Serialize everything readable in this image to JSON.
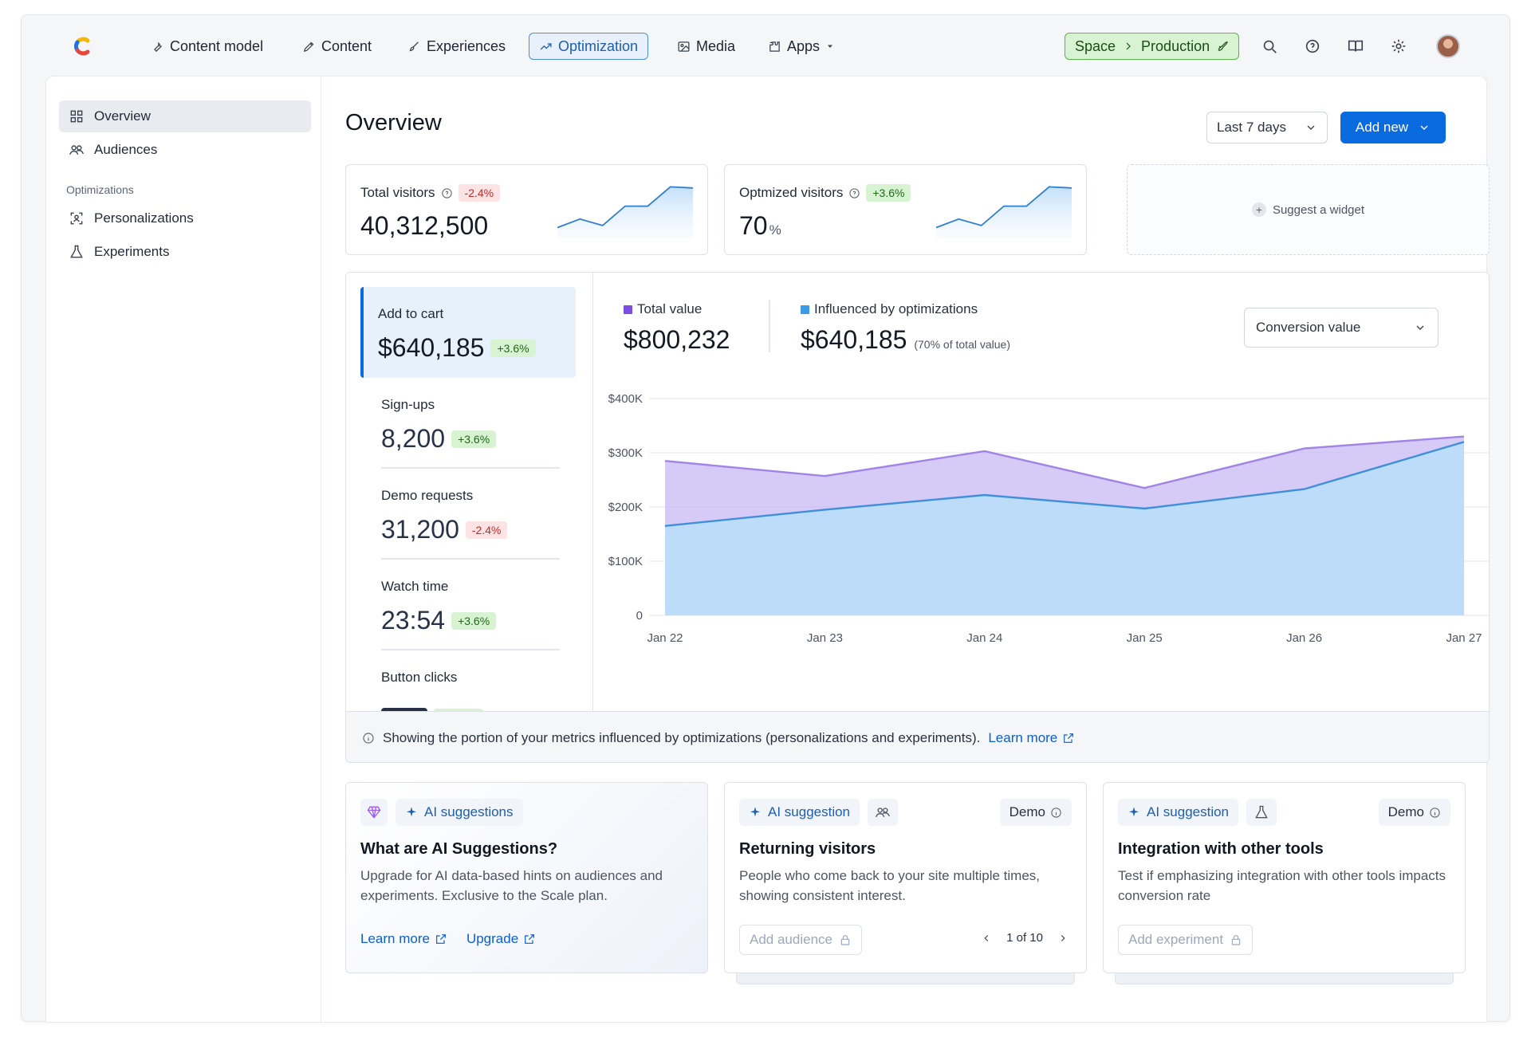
{
  "nav": {
    "items": [
      {
        "label": "Content model",
        "icon": "wrench-icon"
      },
      {
        "label": "Content",
        "icon": "pen-icon"
      },
      {
        "label": "Experiences",
        "icon": "brush-icon"
      },
      {
        "label": "Optimization",
        "icon": "trend-icon",
        "active": true
      },
      {
        "label": "Media",
        "icon": "image-icon"
      },
      {
        "label": "Apps",
        "icon": "puzzle-icon"
      }
    ],
    "space_label": "Space",
    "environment_label": "Production"
  },
  "sidebar": {
    "items": [
      {
        "label": "Overview",
        "active": true
      },
      {
        "label": "Audiences"
      }
    ],
    "section_title": "Optimizations",
    "section_items": [
      {
        "label": "Personalizations"
      },
      {
        "label": "Experiments"
      }
    ]
  },
  "header": {
    "title": "Overview",
    "range": "Last 7 days",
    "add_label": "Add new"
  },
  "kpis": [
    {
      "label": "Total visitors",
      "badge": "-2.4%",
      "value": "40,312,500",
      "unit": "",
      "trend": "negative",
      "spark": [
        40,
        48,
        42,
        60,
        60,
        78,
        77
      ]
    },
    {
      "label": "Optmized visitors",
      "badge": "+3.6%",
      "value": "70",
      "unit": "%",
      "trend": "positive",
      "spark": [
        40,
        48,
        42,
        60,
        60,
        78,
        77
      ]
    }
  ],
  "suggest_widget_label": "Suggest a widget",
  "metrics": [
    {
      "label": "Add to cart",
      "value": "$640,185",
      "badge": "+3.6%",
      "trend": "positive",
      "active": true
    },
    {
      "label": "Sign-ups",
      "value": "8,200",
      "badge": "+3.6%",
      "trend": "positive"
    },
    {
      "label": "Demo requests",
      "value": "31,200",
      "badge": "-2.4%",
      "trend": "negative"
    },
    {
      "label": "Watch time",
      "value": "23:54",
      "badge": "+3.6%",
      "trend": "positive"
    },
    {
      "label": "Button clicks",
      "value": "",
      "badge": "",
      "trend": "positive"
    }
  ],
  "legend": {
    "total_label": "Total value",
    "total_value": "$800,232",
    "influenced_label": "Influenced by optimizations",
    "influenced_value": "$640,185",
    "influenced_note": "(70% of total value)"
  },
  "metric_select": "Conversion value",
  "info_text": "Showing the portion of your metrics influenced by optimizations (personalizations and experiments).",
  "info_link": "Learn more",
  "chart_data": {
    "type": "area",
    "x": [
      "Jan 22",
      "Jan 23",
      "Jan 24",
      "Jan 25",
      "Jan 26",
      "Jan 27"
    ],
    "ylim": [
      0,
      400000
    ],
    "yticks": [
      "0",
      "$100K",
      "$200K",
      "$300K",
      "$400K"
    ],
    "ytick_values": [
      0,
      100000,
      200000,
      300000,
      400000
    ],
    "grid": true,
    "series": [
      {
        "name": "Total value",
        "color": "#c8b8f4",
        "line": "#a084e8",
        "values": [
          285000,
          257000,
          303000,
          235000,
          308000,
          330000
        ]
      },
      {
        "name": "Influenced by optimizations",
        "color": "#bcdcf9",
        "line": "#3f8fdb",
        "values": [
          165000,
          195000,
          222000,
          197000,
          233000,
          320000
        ]
      }
    ]
  },
  "colors": {
    "accent": "#0a6ae0",
    "total_swatch": "#7b4de0",
    "influenced_swatch": "#3c9be8",
    "positive_bg": "#d8f3d2",
    "negative_bg": "#fde3e3"
  },
  "suggestions": [
    {
      "pill": "AI suggestions",
      "title": "What are AI Suggestions?",
      "desc": "Upgrade for AI data-based hints on audiences and experiments. Exclusive to the Scale plan.",
      "link1": "Learn more",
      "link2": "Upgrade"
    },
    {
      "pill": "AI suggestion",
      "icon": "audience-icon",
      "demo": "Demo",
      "title": "Returning visitors",
      "desc": "People who come back to your site multiple times, showing consistent interest.",
      "button": "Add audience",
      "pager": "1 of 10"
    },
    {
      "pill": "AI suggestion",
      "icon": "flask-icon",
      "demo": "Demo",
      "title": "Integration with other tools",
      "desc": "Test if emphasizing integration with other tools impacts conversion rate",
      "button": "Add experiment"
    }
  ]
}
